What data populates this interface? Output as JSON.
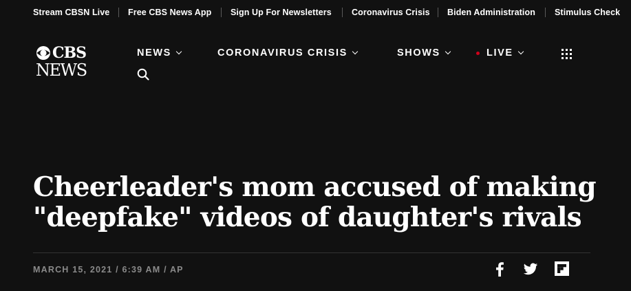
{
  "topbar": {
    "links": [
      "Stream CBSN Live",
      "Free CBS News App",
      "Sign Up For Newsletters",
      "Coronavirus Crisis",
      "Biden Administration",
      "Stimulus Check"
    ]
  },
  "logo": {
    "line1": "CBS",
    "line2": "NEWS"
  },
  "nav": {
    "news": "NEWS",
    "coronavirus": "CORONAVIRUS CRISIS",
    "shows": "SHOWS",
    "live": "LIVE",
    "icons": {
      "menu": "grid-icon",
      "search": "search-icon"
    }
  },
  "article": {
    "headline": "Cheerleader's mom accused of making \"deepfake\" videos of daughter's rivals",
    "date": "MARCH 15, 2021",
    "time": "6:39 AM",
    "source": "AP",
    "separator": "/"
  },
  "share": {
    "icons": [
      "facebook-icon",
      "twitter-icon",
      "flipboard-icon"
    ]
  },
  "colors": {
    "background": "#111111",
    "text": "#ffffff",
    "byline": "#8a8a8a",
    "live_dot": "#d0021b",
    "divider": "#333333"
  }
}
